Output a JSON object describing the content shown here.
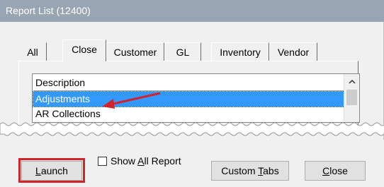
{
  "window": {
    "title": "Report List (12400)"
  },
  "tabs": [
    {
      "label": "All",
      "active": false
    },
    {
      "label": "Close",
      "active": true
    },
    {
      "label": "Customer",
      "active": false
    },
    {
      "label": "GL",
      "active": false
    },
    {
      "label": "Inventory",
      "active": false
    },
    {
      "label": "Vendor",
      "active": false
    }
  ],
  "list": {
    "header": "Description",
    "rows": [
      {
        "label": "Adjustments",
        "selected": true
      },
      {
        "label": "AR Collections",
        "selected": false
      }
    ]
  },
  "footer": {
    "launch": {
      "pre": "",
      "mnemonic": "L",
      "post": "aunch"
    },
    "show_all": {
      "pre": "Show ",
      "mnemonic": "A",
      "post": "ll Report"
    },
    "custom_tabs": {
      "pre": "Custom ",
      "mnemonic": "T",
      "post": "abs"
    },
    "close": {
      "pre": "",
      "mnemonic": "C",
      "post": "lose"
    }
  },
  "colors": {
    "selection": "#3399ff",
    "annotation_red": "#d2232a",
    "titlebar": "#9aa5b3"
  }
}
